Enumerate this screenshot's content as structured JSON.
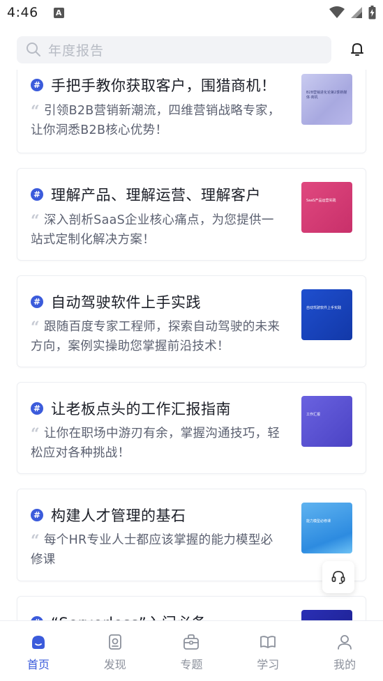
{
  "status_bar": {
    "time": "4:46",
    "badge": "A"
  },
  "search": {
    "placeholder": "年度报告"
  },
  "colors": {
    "accent": "#3b5bdb",
    "text": "#1b1e27",
    "muted": "#5b6070",
    "nav_inactive": "#8b909b"
  },
  "cards": [
    {
      "title": "手把手教你获取客户，围猎商机！",
      "desc": "引领B2B营销新潮流，四维营销战略专家，让你洞悉B2B核心优势！",
      "thumb_text": "B2B营销进化论第2季新媒体·商机"
    },
    {
      "title": "理解产品、理解运营、理解客户",
      "desc": "深入剖析SaaS企业核心痛点，为您提供一站式定制化解决方案！",
      "thumb_text": "SaaS产品运营实践"
    },
    {
      "title": "自动驾驶软件上手实践",
      "desc": "跟随百度专家工程师，探索自动驾驶的未来方向，案例实操助您掌握前沿技术！",
      "thumb_text": "自动驾驶软件上手实践"
    },
    {
      "title": "让老板点头的工作汇报指南",
      "desc": "让你在职场中游刃有余，掌握沟通技巧，轻松应对各种挑战！",
      "thumb_text": "工作汇报"
    },
    {
      "title": "构建人才管理的基石",
      "desc": "每个HR专业人士都应该掌握的能力模型必修课",
      "thumb_text": "能力模型必修课"
    },
    {
      "title": "“Serverless”入门必备",
      "desc": "",
      "thumb_text": ""
    }
  ],
  "nav": {
    "items": [
      {
        "label": "首页",
        "icon": "home-icon",
        "active": true
      },
      {
        "label": "发现",
        "icon": "discover-icon",
        "active": false
      },
      {
        "label": "专题",
        "icon": "topic-icon",
        "active": false
      },
      {
        "label": "学习",
        "icon": "study-icon",
        "active": false
      },
      {
        "label": "我的",
        "icon": "profile-icon",
        "active": false
      }
    ]
  }
}
